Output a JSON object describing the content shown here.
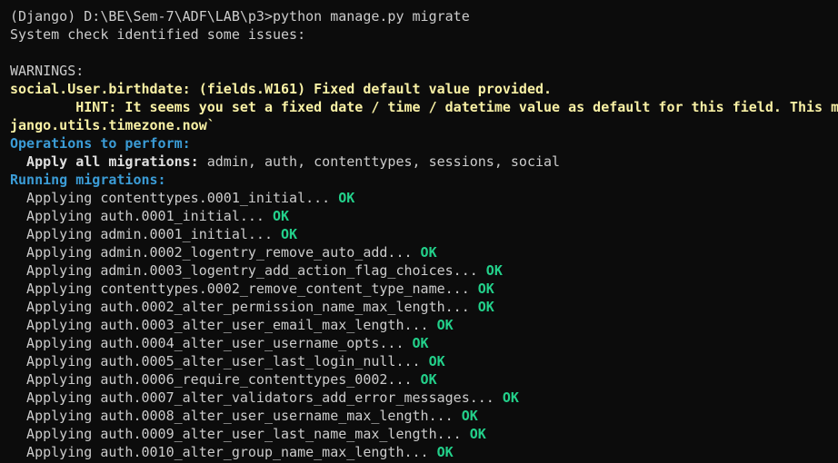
{
  "colors": {
    "background": "#0c0c0c",
    "text": "#cccccc",
    "warning": "#f9f1a5",
    "heading": "#3b9cd6",
    "ok": "#23d18b"
  },
  "terminal": {
    "prompt_line": "(Django) D:\\BE\\Sem-7\\ADF\\LAB\\p3>python manage.py migrate",
    "system_check": "System check identified some issues:",
    "warnings_label": "WARNINGS:",
    "warning_line": "social.User.birthdate: (fields.W161) Fixed default value provided.",
    "hint_line": "        HINT: It seems you set a fixed date / time / datetime value as default for this field. This ma",
    "hint_cont": "jango.utils.timezone.now`",
    "operations_label": "Operations to perform:",
    "apply_all_label": "  Apply all migrations:",
    "apply_all_value": " admin, auth, contenttypes, sessions, social",
    "running_label": "Running migrations:",
    "ok_label": "OK",
    "migrations": [
      "  Applying contenttypes.0001_initial... ",
      "  Applying auth.0001_initial... ",
      "  Applying admin.0001_initial... ",
      "  Applying admin.0002_logentry_remove_auto_add... ",
      "  Applying admin.0003_logentry_add_action_flag_choices... ",
      "  Applying contenttypes.0002_remove_content_type_name... ",
      "  Applying auth.0002_alter_permission_name_max_length... ",
      "  Applying auth.0003_alter_user_email_max_length... ",
      "  Applying auth.0004_alter_user_username_opts... ",
      "  Applying auth.0005_alter_user_last_login_null... ",
      "  Applying auth.0006_require_contenttypes_0002... ",
      "  Applying auth.0007_alter_validators_add_error_messages... ",
      "  Applying auth.0008_alter_user_username_max_length... ",
      "  Applying auth.0009_alter_user_last_name_max_length... ",
      "  Applying auth.0010_alter_group_name_max_length... "
    ]
  }
}
